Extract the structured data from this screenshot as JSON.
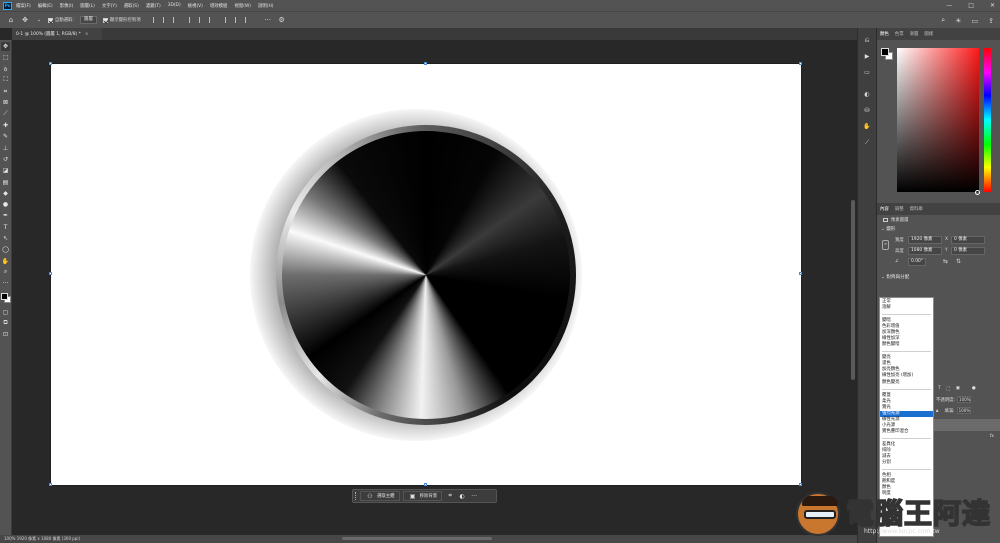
{
  "app": {
    "logo": "Ps"
  },
  "menu": [
    "檔案(F)",
    "編輯(E)",
    "影像(I)",
    "圖層(L)",
    "文字(Y)",
    "選取(S)",
    "濾鏡(T)",
    "3D(D)",
    "檢視(V)",
    "增效模組",
    "視窗(W)",
    "說明(H)"
  ],
  "window_controls": [
    "—",
    "□",
    "✕"
  ],
  "options": {
    "auto_select_label": "自動選取:",
    "auto_select_value": "圖層",
    "show_transform_label": "顯示變形控制項"
  },
  "doc_tab": {
    "title": "0-1 @ 100% (圖層 1, RGB/8) *",
    "close": "×"
  },
  "context_bar": {
    "select_subject": "選取主體",
    "remove_bg": "移除背景",
    "more": "···"
  },
  "status": {
    "text": "100%   1920 像素 x 1080 像素 (300 ppi)"
  },
  "color_panel": {
    "tabs": [
      "顏色",
      "色票",
      "漸層",
      "圖樣"
    ]
  },
  "properties": {
    "tabs": [
      "內容",
      "調整",
      "資料庫"
    ],
    "doc_label": "像素圖層",
    "transform_title": "變形",
    "width_label": "寬度",
    "width_value": "1920 像素",
    "height_label": "高度",
    "height_value": "1080 像素",
    "x_label": "X",
    "x_value": "0 像素",
    "y_label": "Y",
    "y_value": "0 像素",
    "angle_value": "0.00°",
    "align_title": "對齊與分配"
  },
  "blend_modes": [
    [
      "正常",
      "溶解"
    ],
    [
      "變暗",
      "色彩增值",
      "加深顏色",
      "線性加深",
      "顏色變暗"
    ],
    [
      "變亮",
      "濾色",
      "加亮顏色",
      "線性加亮 (增加)",
      "顏色變亮"
    ],
    [
      "覆蓋",
      "柔光",
      "實光",
      "強烈光源",
      "線性光源",
      "小光源",
      "實色疊印混合"
    ],
    [
      "差異化",
      "排除",
      "減去",
      "分割"
    ],
    [
      "色相",
      "飽和度",
      "顏色",
      "明度"
    ]
  ],
  "blend_selected": "強烈光源",
  "layers": {
    "opacity_label": "不透明度:",
    "opacity_value": "100%",
    "fill_label": "填滿:",
    "fill_value": "100%",
    "fx": "fx"
  },
  "watermark": {
    "title": "電腦王阿達",
    "url": "http://www.kocpc.com.tw"
  }
}
